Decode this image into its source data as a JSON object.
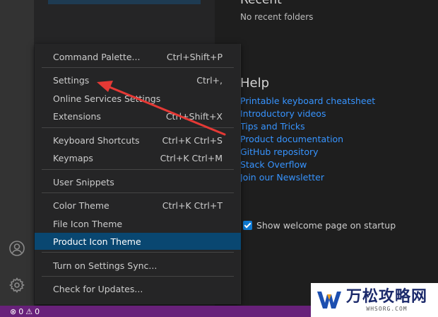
{
  "welcome": {
    "recent_title": "Recent",
    "recent_empty": "No recent folders",
    "help_title": "Help",
    "help_links": [
      "Printable keyboard cheatsheet",
      "Introductory videos",
      "Tips and Tricks",
      "Product documentation",
      "GitHub repository",
      "Stack Overflow",
      "Join our Newsletter"
    ],
    "startup_label": "Show welcome page on startup",
    "startup_checked": true
  },
  "menu": {
    "items": [
      {
        "label": "Command Palette...",
        "shortcut": "Ctrl+Shift+P"
      },
      {
        "label": "Settings",
        "shortcut": "Ctrl+,"
      },
      {
        "label": "Online Services Settings",
        "shortcut": ""
      },
      {
        "label": "Extensions",
        "shortcut": "Ctrl+Shift+X"
      },
      {
        "label": "Keyboard Shortcuts",
        "shortcut": "Ctrl+K Ctrl+S"
      },
      {
        "label": "Keymaps",
        "shortcut": "Ctrl+K Ctrl+M"
      },
      {
        "label": "User Snippets",
        "shortcut": ""
      },
      {
        "label": "Color Theme",
        "shortcut": "Ctrl+K Ctrl+T"
      },
      {
        "label": "File Icon Theme",
        "shortcut": ""
      },
      {
        "label": "Product Icon Theme",
        "shortcut": ""
      },
      {
        "label": "Turn on Settings Sync...",
        "shortcut": ""
      },
      {
        "label": "Check for Updates...",
        "shortcut": ""
      }
    ],
    "active_item": "Product Icon Theme"
  },
  "activity_bar": {
    "icons": [
      "account-icon",
      "gear-icon"
    ]
  },
  "status_bar": {
    "errors": "0",
    "warnings": "0",
    "color": "#68217a"
  },
  "watermark": {
    "title": "万松攻略网",
    "subtitle": "WHSORG.COM"
  },
  "colors": {
    "accent": "#094771",
    "link": "#3794ff",
    "annotation_arrow": "#e53935"
  }
}
